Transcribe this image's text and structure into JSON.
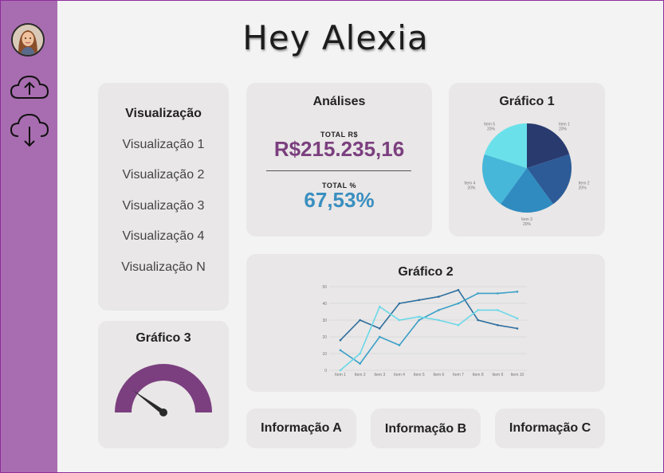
{
  "header": {
    "greeting": "Hey Alexia"
  },
  "sidebar": {
    "items": [
      {
        "icon": "avatar"
      },
      {
        "icon": "cloud-upload-icon"
      },
      {
        "icon": "cloud-download-icon"
      }
    ]
  },
  "visualizacao": {
    "title": "Visualização",
    "items": [
      "Visualização 1",
      "Visualização 2",
      "Visualização 3",
      "Visualização 4",
      "Visualização N"
    ]
  },
  "analises": {
    "title": "Análises",
    "total_rs_label": "TOTAL R$",
    "total_rs_value": "R$215.235,16",
    "total_pct_label": "TOTAL %",
    "total_pct_value": "67,53%",
    "colors": {
      "rs": "#7b3f7f",
      "pct": "#3a8fc0"
    }
  },
  "grafico1": {
    "title": "Gráfico 1",
    "chart_data": {
      "type": "pie",
      "labels": [
        "Item 1",
        "Item 2",
        "Item 3",
        "Item 4",
        "Item 5"
      ],
      "values": [
        20,
        20,
        20,
        20,
        20
      ],
      "value_labels": [
        "20%",
        "20%",
        "20%",
        "20%",
        "20%"
      ],
      "colors": [
        "#283a6e",
        "#2c5b97",
        "#2f8bc0",
        "#46b7d9",
        "#6ae1ea"
      ]
    }
  },
  "grafico2": {
    "title": "Gráfico 2",
    "chart_data": {
      "type": "line",
      "categories": [
        "Item 1",
        "Item 2",
        "Item 3",
        "Item 4",
        "Item 5",
        "Item 6",
        "Item 7",
        "Item 8",
        "Item 9",
        "Item 10"
      ],
      "ylim": [
        0,
        50
      ],
      "yticks": [
        "0",
        "10",
        "20",
        "30",
        "40",
        "50"
      ],
      "series": [
        {
          "values": [
            18,
            30,
            25,
            40,
            42,
            44,
            48,
            30,
            27,
            25
          ],
          "color": "#2e6f9e"
        },
        {
          "values": [
            12,
            4,
            20,
            15,
            30,
            36,
            40,
            46,
            46,
            47
          ],
          "color": "#3aa0c8"
        },
        {
          "values": [
            0,
            10,
            38,
            30,
            32,
            30,
            27,
            36,
            36,
            31
          ],
          "color": "#6ad8e8"
        }
      ]
    }
  },
  "grafico3": {
    "title": "Gráfico 3",
    "gauge": {
      "level": 0.2,
      "color": "#7b3f7f"
    }
  },
  "info": {
    "a": "Informação A",
    "b": "Informação B",
    "c": "Informação C"
  }
}
